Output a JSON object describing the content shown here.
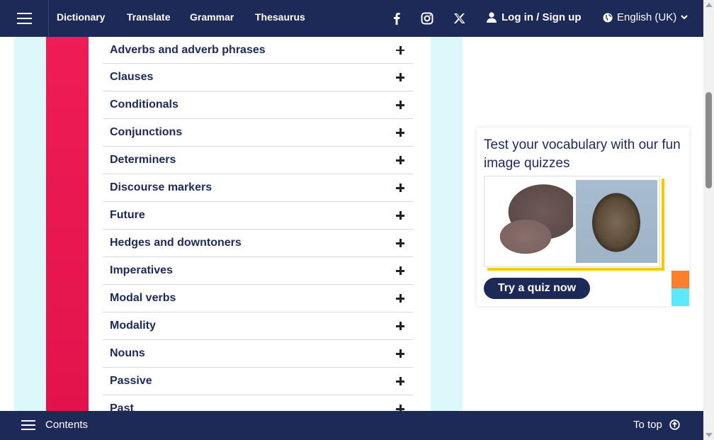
{
  "nav": {
    "links": [
      "Dictionary",
      "Translate",
      "Grammar",
      "Thesaurus"
    ],
    "login_label": "Log in / Sign up",
    "language_label": "English (UK)"
  },
  "social_icons": [
    "facebook-icon",
    "instagram-icon",
    "x-icon"
  ],
  "accordion": {
    "items": [
      "Adverbs and adverb phrases",
      "Clauses",
      "Conditionals",
      "Conjunctions",
      "Determiners",
      "Discourse markers",
      "Future",
      "Hedges and downtoners",
      "Imperatives",
      "Modal verbs",
      "Modality",
      "Nouns",
      "Passive",
      "Past"
    ]
  },
  "promo": {
    "title": "Test your vocabulary with our fun image quizzes",
    "button_label": "Try a quiz now"
  },
  "footer": {
    "contents_label": "Contents",
    "to_top_label": "To top"
  },
  "colors": {
    "navy": "#1d2a57",
    "red": "#ef1c55",
    "cyan_bg": "#dcf8fb",
    "yellow": "#ffc700",
    "orange": "#fe7f2a",
    "cyan_accent": "#5ce8ff"
  }
}
